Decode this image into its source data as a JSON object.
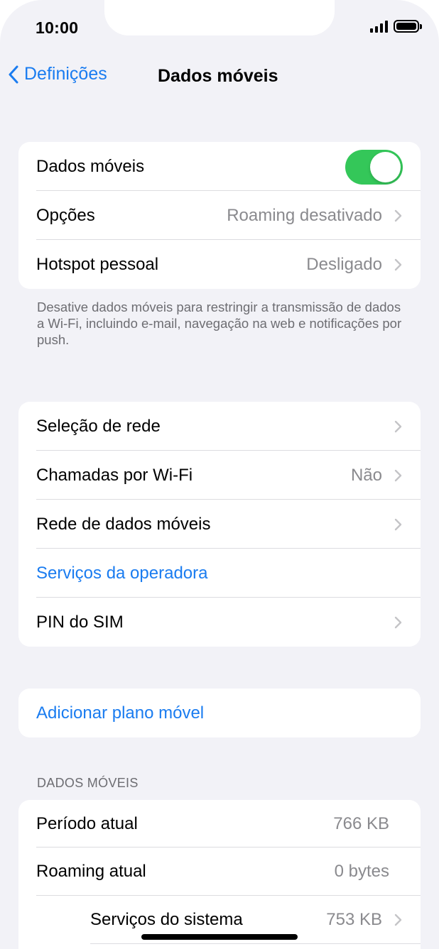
{
  "status": {
    "time": "10:00"
  },
  "nav": {
    "back_label": "Definições",
    "title": "Dados móveis"
  },
  "group1": {
    "mobile_data": {
      "label": "Dados móveis",
      "enabled": true
    },
    "options": {
      "label": "Opções",
      "value": "Roaming desativado"
    },
    "hotspot": {
      "label": "Hotspot pessoal",
      "value": "Desligado"
    }
  },
  "footnote": "Desative dados móveis para restringir a transmissão de dados a Wi-Fi, incluindo e-mail, navegação na web e notificações por push.",
  "group2": {
    "network_selection": {
      "label": "Seleção de rede"
    },
    "wifi_calling": {
      "label": "Chamadas por Wi-Fi",
      "value": "Não"
    },
    "cellular_network": {
      "label": "Rede de dados móveis"
    },
    "carrier_services": {
      "label": "Serviços da operadora"
    },
    "sim_pin": {
      "label": "PIN do SIM"
    }
  },
  "group3": {
    "add_plan": {
      "label": "Adicionar plano móvel"
    }
  },
  "usage": {
    "header": "DADOS MÓVEIS",
    "current_period": {
      "label": "Período atual",
      "value": "766 KB"
    },
    "current_roaming": {
      "label": "Roaming atual",
      "value": "0 bytes"
    },
    "system_services": {
      "label": "Serviços do sistema",
      "value": "753 KB"
    }
  },
  "colors": {
    "accent": "#1a7cf0",
    "toggle_on": "#34c759",
    "background": "#f2f2f7"
  }
}
